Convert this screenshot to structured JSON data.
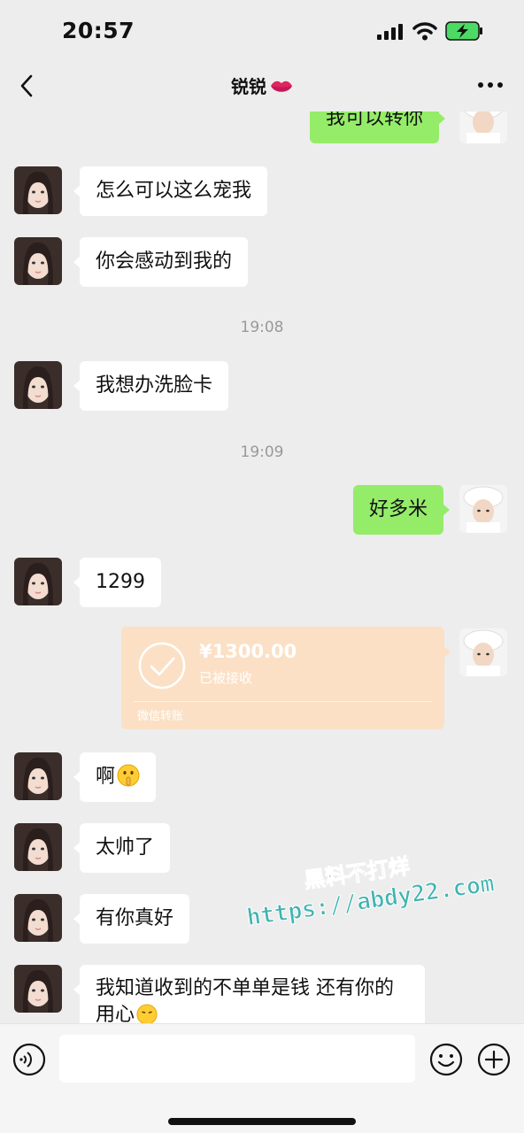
{
  "status_bar": {
    "time": "20:57"
  },
  "header": {
    "title": "锐锐"
  },
  "messages": [
    {
      "side": "out",
      "text": "我可以转你"
    },
    {
      "side": "in",
      "text": "怎么可以这么宠我"
    },
    {
      "side": "in",
      "text": "你会感动到我的"
    },
    {
      "type": "time",
      "text": "19:08"
    },
    {
      "side": "in",
      "text": "我想办洗脸卡"
    },
    {
      "type": "time",
      "text": "19:09"
    },
    {
      "side": "out",
      "text": "好多米"
    },
    {
      "side": "in",
      "text": "1299"
    },
    {
      "side": "in",
      "text": "啊"
    },
    {
      "side": "in",
      "text": "太帅了"
    },
    {
      "side": "in",
      "text": "有你真好"
    },
    {
      "side": "in",
      "text": "我知道收到的不单单是钱 还有你的用心"
    }
  ],
  "transfer": {
    "amount": "¥1300.00",
    "status": "已被接收",
    "footer": "微信转账"
  },
  "watermark": {
    "line1": "黑料不打烊",
    "line2": "https://abdy22.com"
  },
  "input": {
    "placeholder": ""
  },
  "colors": {
    "background": "#ededed",
    "outgoing_bubble": "#95ec69",
    "incoming_bubble": "#ffffff",
    "transfer_card": "#fbe0c5"
  }
}
